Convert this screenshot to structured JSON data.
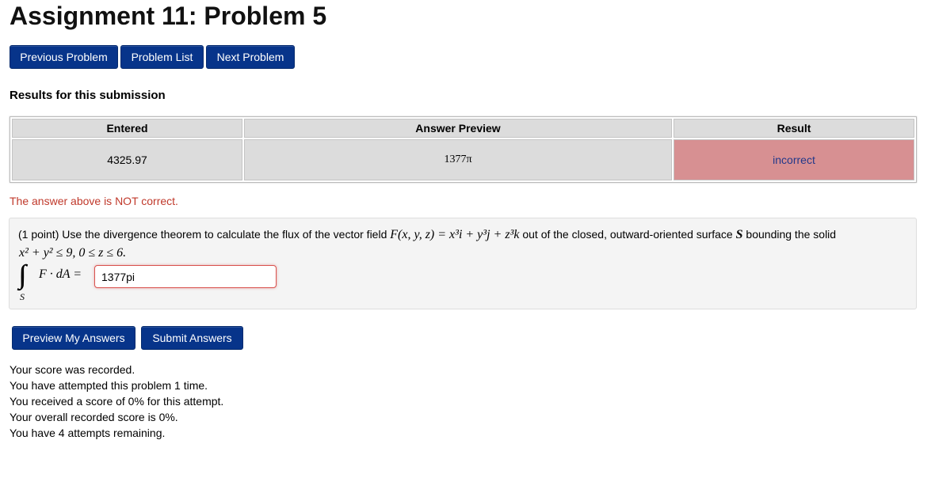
{
  "page": {
    "title": "Assignment 11: Problem 5"
  },
  "nav": {
    "previous_label": "Previous Problem",
    "list_label": "Problem List",
    "next_label": "Next Problem"
  },
  "results": {
    "heading": "Results for this submission",
    "columns": [
      "Entered",
      "Answer Preview",
      "Result"
    ],
    "row": {
      "entered": "4325.97",
      "preview": "1377π",
      "result": "incorrect"
    },
    "result_color": "#d79092",
    "message": "The answer above is NOT correct."
  },
  "problem": {
    "points": "(1 point)",
    "text_before": "Use the divergence theorem to calculate the flux of the vector field",
    "field": "F(x, y, z) = x³i + y³j + z³k",
    "text_middle": "out of the closed, outward-oriented surface",
    "surface": "S",
    "text_after": "bounding the solid",
    "region": "x² + y² ≤ 9,  0 ≤ z ≤ 6.",
    "integral_sub": "S",
    "integrand": "F · dA =",
    "answer_value": "1377pi"
  },
  "actions": {
    "preview_label": "Preview My Answers",
    "submit_label": "Submit Answers"
  },
  "score": {
    "lines": [
      "Your score was recorded.",
      "You have attempted this problem 1 time.",
      "You received a score of 0% for this attempt.",
      "Your overall recorded score is 0%.",
      "You have 4 attempts remaining."
    ]
  },
  "colors": {
    "button": "#07348a",
    "error_text": "#c0392b"
  }
}
